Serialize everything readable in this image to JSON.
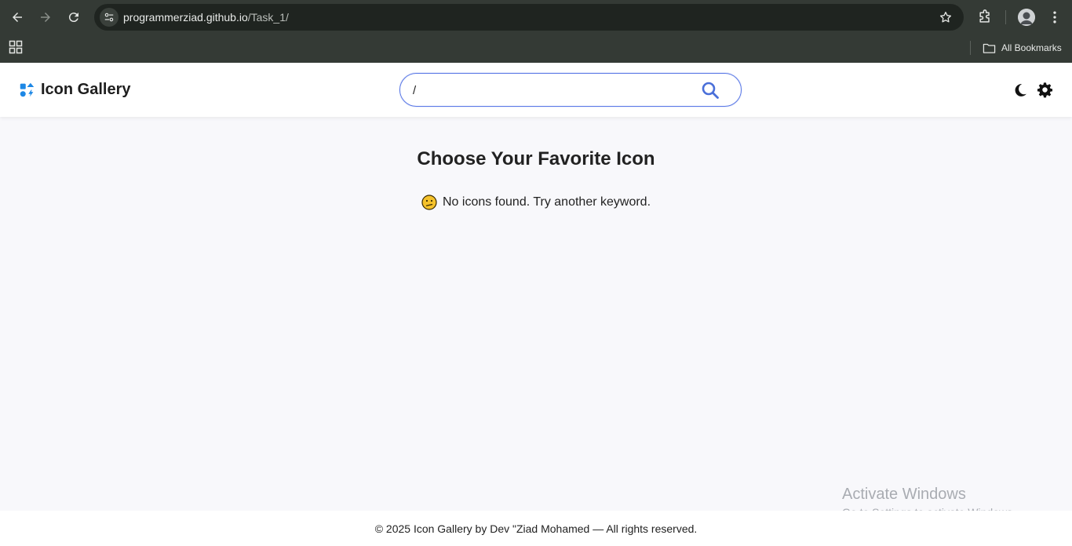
{
  "browser": {
    "url_host": "programmerziad.github.io",
    "url_path": "/Task_1/",
    "bookmarks_label": "All Bookmarks"
  },
  "header": {
    "title": "Icon Gallery",
    "search": {
      "value": "/"
    }
  },
  "main": {
    "title": "Choose Your Favorite Icon",
    "empty_message": "No icons found. Try another keyword."
  },
  "watermark": {
    "line1": "Activate Windows",
    "line2": "Go to Settings to activate Windows."
  },
  "footer": {
    "text": "© 2025 Icon Gallery by Dev \"Ziad Mohamed — All rights reserved."
  },
  "icons": {
    "back": "arrow-left-icon",
    "forward": "arrow-right-icon",
    "reload": "reload-icon",
    "site_info": "tune-icon",
    "bookmark": "star-icon",
    "extensions": "puzzle-icon",
    "menu": "kebab-icon",
    "apps": "apps-grid-icon",
    "folder": "folder-icon",
    "brand": "icons-logo-icon",
    "search": "search-icon",
    "theme": "moon-icon",
    "settings": "gear-icon",
    "empty": "confused-face-icon"
  },
  "colors": {
    "accent": "#5a78e6",
    "brand_blue": "#1e88e5",
    "chrome_bg": "#343a35",
    "page_bg": "#f8f8fb"
  }
}
